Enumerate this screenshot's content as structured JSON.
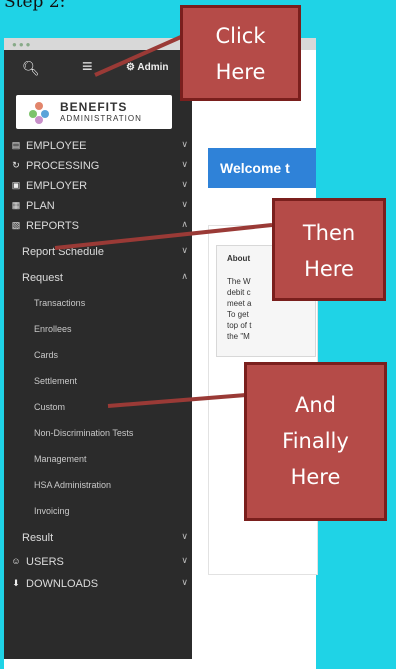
{
  "step_label": "Step 2:",
  "toolbar": {
    "admin_label": "Admin"
  },
  "logo": {
    "line1": "BENEFITS",
    "line2": "ADMINISTRATION"
  },
  "sidebar": {
    "items": [
      {
        "label": "EMPLOYEE",
        "icon": "id-card-icon"
      },
      {
        "label": "PROCESSING",
        "icon": "refresh-icon"
      },
      {
        "label": "EMPLOYER",
        "icon": "briefcase-icon"
      },
      {
        "label": "PLAN",
        "icon": "calendar-icon"
      },
      {
        "label": "REPORTS",
        "icon": "report-icon"
      }
    ],
    "reports_sub": {
      "report_schedule": "Report Schedule",
      "request": "Request",
      "result": "Result"
    },
    "request_items": [
      "Transactions",
      "Enrollees",
      "Cards",
      "Settlement",
      "Custom",
      "Non-Discrimination Tests",
      "Management",
      "HSA Administration",
      "Invoicing"
    ],
    "bottom_items": [
      {
        "label": "USERS",
        "icon": "users-icon"
      },
      {
        "label": "DOWNLOADS",
        "icon": "download-icon"
      }
    ]
  },
  "main": {
    "welcome_title": "Welcome t",
    "about_title": "About",
    "about_lines": [
      "The W",
      "debit c",
      "meet a",
      "To get",
      "top of t",
      "the \"M"
    ]
  },
  "callouts": {
    "click": [
      "Click",
      "Here"
    ],
    "then": [
      "Then",
      "Here"
    ],
    "finally": [
      "And",
      "Finally",
      "Here"
    ]
  },
  "colors": {
    "background": "#1fd3e6",
    "sidebar": "#2b2b2b",
    "callout": "#b54b48",
    "callout_border": "#7a1f1d",
    "welcome_bar": "#2f82d8"
  }
}
